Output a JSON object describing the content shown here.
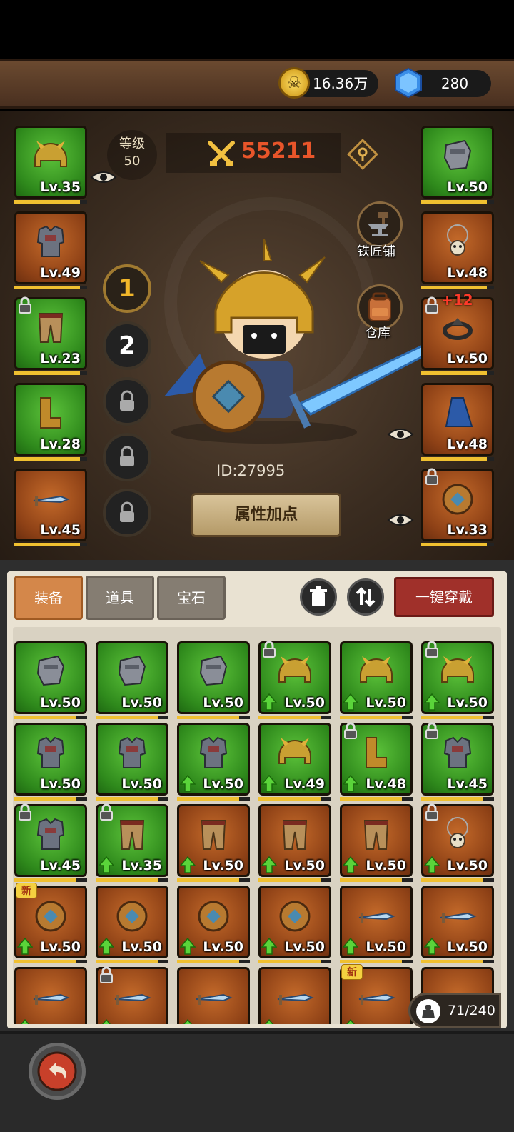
{
  "currency": {
    "gold": "16.36万",
    "gems": "280"
  },
  "character": {
    "level_label": "等级",
    "level": "50",
    "power": "55211",
    "id": "ID:27995",
    "attr_button": "属性加点",
    "blacksmith": "铁匠铺",
    "warehouse": "仓库"
  },
  "loadouts": [
    "1",
    "2"
  ],
  "left_slots": [
    {
      "lv": "Lv.35",
      "kind": "helmet",
      "color": "green",
      "progress": 0.9,
      "locked": false,
      "eye": true
    },
    {
      "lv": "Lv.49",
      "kind": "armor",
      "color": "orange",
      "progress": 0.9,
      "locked": false
    },
    {
      "lv": "Lv.23",
      "kind": "pants",
      "color": "green",
      "progress": 0.9,
      "locked": true
    },
    {
      "lv": "Lv.28",
      "kind": "boots",
      "color": "green",
      "progress": 0.9,
      "locked": false
    },
    {
      "lv": "Lv.45",
      "kind": "sword",
      "color": "orange",
      "progress": 0.9,
      "locked": false
    }
  ],
  "right_slots": [
    {
      "lv": "Lv.50",
      "kind": "gauntlet",
      "color": "green",
      "progress": 0.9,
      "locked": false
    },
    {
      "lv": "Lv.48",
      "kind": "necklace",
      "color": "orange",
      "progress": 0.9,
      "locked": false
    },
    {
      "lv": "Lv.50",
      "kind": "ring",
      "color": "orange",
      "progress": 0.9,
      "locked": true,
      "plus": "+12"
    },
    {
      "lv": "Lv.48",
      "kind": "cape",
      "color": "orange",
      "progress": 0.9,
      "locked": false,
      "eye": true
    },
    {
      "lv": "Lv.33",
      "kind": "shield",
      "color": "orange",
      "progress": 0.9,
      "locked": true,
      "eye": true
    }
  ],
  "tabs": [
    "装备",
    "道具",
    "宝石"
  ],
  "wear_all": "一键穿戴",
  "bag_count": "71/240",
  "new_badge": "新",
  "inventory": [
    {
      "lv": "Lv.50",
      "kind": "gauntlet",
      "color": "green",
      "progress": 0.85,
      "up": false,
      "locked": false
    },
    {
      "lv": "Lv.50",
      "kind": "gauntlet",
      "color": "green",
      "progress": 0.85,
      "up": false,
      "locked": false
    },
    {
      "lv": "Lv.50",
      "kind": "gauntlet",
      "color": "green",
      "progress": 0.85,
      "up": false,
      "locked": false
    },
    {
      "lv": "Lv.50",
      "kind": "helmet",
      "color": "green",
      "progress": 0.85,
      "up": true,
      "locked": true
    },
    {
      "lv": "Lv.50",
      "kind": "helmet",
      "color": "green",
      "progress": 0.85,
      "up": true,
      "locked": false
    },
    {
      "lv": "Lv.50",
      "kind": "helmet",
      "color": "green",
      "progress": 0.85,
      "up": true,
      "locked": true
    },
    {
      "lv": "Lv.50",
      "kind": "armor",
      "color": "green",
      "progress": 0.85,
      "up": false,
      "locked": false
    },
    {
      "lv": "Lv.50",
      "kind": "armor",
      "color": "green",
      "progress": 0.85,
      "up": false,
      "locked": false
    },
    {
      "lv": "Lv.50",
      "kind": "armor",
      "color": "green",
      "progress": 0.85,
      "up": true,
      "locked": false
    },
    {
      "lv": "Lv.49",
      "kind": "helmet",
      "color": "green",
      "progress": 0.85,
      "up": true,
      "locked": false
    },
    {
      "lv": "Lv.48",
      "kind": "boots",
      "color": "green",
      "progress": 0.85,
      "up": true,
      "locked": true
    },
    {
      "lv": "Lv.45",
      "kind": "armor",
      "color": "green",
      "progress": 0.85,
      "up": false,
      "locked": true
    },
    {
      "lv": "Lv.45",
      "kind": "armor",
      "color": "green",
      "progress": 0.85,
      "up": false,
      "locked": true
    },
    {
      "lv": "Lv.35",
      "kind": "pants",
      "color": "green",
      "progress": 0.85,
      "up": true,
      "locked": true
    },
    {
      "lv": "Lv.50",
      "kind": "pants",
      "color": "orange",
      "progress": 0.85,
      "up": true,
      "locked": false
    },
    {
      "lv": "Lv.50",
      "kind": "pants",
      "color": "orange",
      "progress": 0.85,
      "up": true,
      "locked": false
    },
    {
      "lv": "Lv.50",
      "kind": "pants",
      "color": "orange",
      "progress": 0.85,
      "up": true,
      "locked": false
    },
    {
      "lv": "Lv.50",
      "kind": "necklace",
      "color": "orange",
      "progress": 0.85,
      "up": true,
      "locked": true
    },
    {
      "lv": "Lv.50",
      "kind": "shield",
      "color": "orange",
      "progress": 0.85,
      "up": true,
      "locked": false,
      "new": true
    },
    {
      "lv": "Lv.50",
      "kind": "shield",
      "color": "orange",
      "progress": 0.85,
      "up": true,
      "locked": false
    },
    {
      "lv": "Lv.50",
      "kind": "shield",
      "color": "orange",
      "progress": 0.85,
      "up": true,
      "locked": false
    },
    {
      "lv": "Lv.50",
      "kind": "shield",
      "color": "orange",
      "progress": 0.85,
      "up": true,
      "locked": false
    },
    {
      "lv": "Lv.50",
      "kind": "sword",
      "color": "orange",
      "progress": 0.85,
      "up": true,
      "locked": false
    },
    {
      "lv": "Lv.50",
      "kind": "sword",
      "color": "orange",
      "progress": 0.85,
      "up": true,
      "locked": false
    },
    {
      "lv": "",
      "kind": "sword",
      "color": "orange",
      "progress": 0,
      "up": true,
      "locked": false
    },
    {
      "lv": "",
      "kind": "sword",
      "color": "orange",
      "progress": 0,
      "up": true,
      "locked": true
    },
    {
      "lv": "",
      "kind": "sword",
      "color": "orange",
      "progress": 0,
      "up": true,
      "locked": false
    },
    {
      "lv": "",
      "kind": "sword",
      "color": "orange",
      "progress": 0,
      "up": true,
      "locked": false
    },
    {
      "lv": "",
      "kind": "sword",
      "color": "orange",
      "progress": 0,
      "up": true,
      "locked": false,
      "new": true
    },
    {
      "lv": "",
      "kind": "sword",
      "color": "orange",
      "progress": 0,
      "up": false,
      "locked": false
    }
  ]
}
